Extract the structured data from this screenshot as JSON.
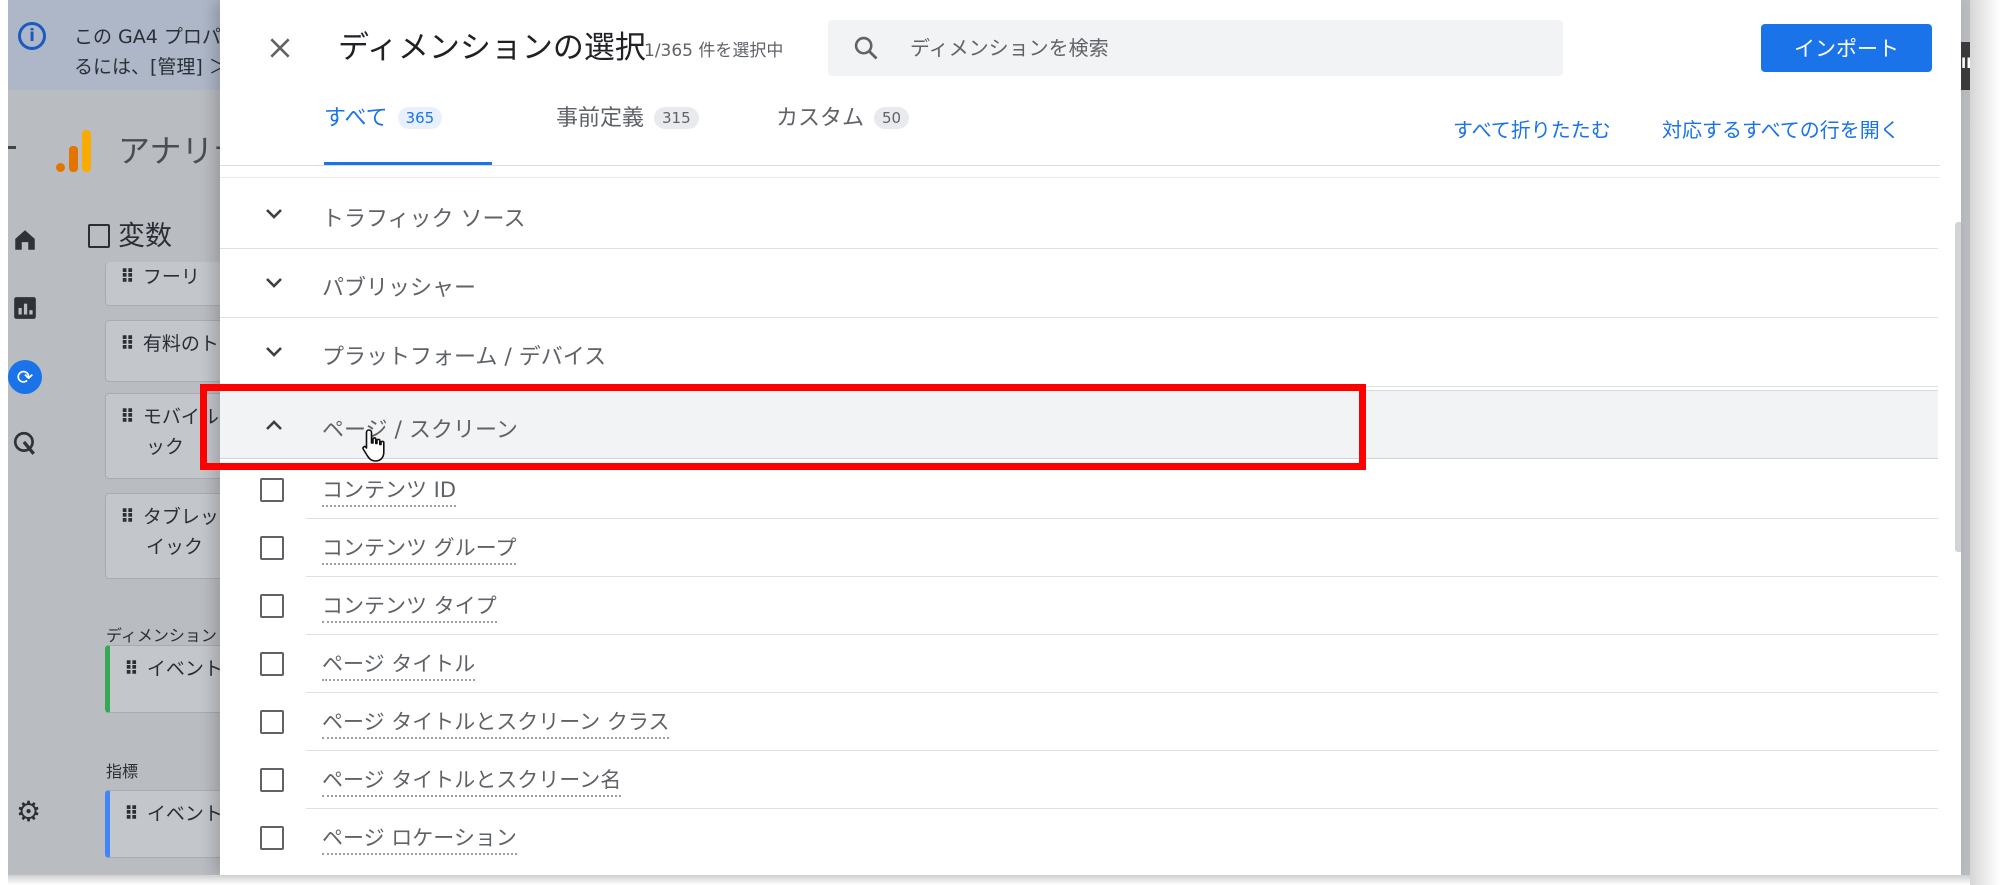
{
  "background": {
    "banner": {
      "line1": "この GA4 プロパ",
      "line2": "るには、[管理] ＞"
    },
    "app_name": "アナリテ",
    "variables_title": "変数",
    "cards": [
      "フーリ",
      "有料のト",
      "モバイル",
      "ック",
      "タブレッ",
      "イック"
    ],
    "dimensions_label": "ディメンション",
    "metrics_label": "指標",
    "event_card": "イベント",
    "metric_card": "イベント",
    "right_tab": "IN"
  },
  "dialog": {
    "title": "ディメンションの選択",
    "selected_count": "1/365 件を選択中",
    "search_placeholder": "ディメンションを検索",
    "import_label": "インポート",
    "tabs": [
      {
        "label": "すべて",
        "count": "365"
      },
      {
        "label": "事前定義",
        "count": "315"
      },
      {
        "label": "カスタム",
        "count": "50"
      }
    ],
    "collapse_all": "すべて折りたたむ",
    "expand_all": "対応するすべての行を開く",
    "categories": [
      "トラフィック ソース",
      "パブリッシャー",
      "プラットフォーム / デバイス",
      "ページ / スクリーン"
    ],
    "dimensions": [
      "コンテンツ ID",
      "コンテンツ グループ",
      "コンテンツ タイプ",
      "ページ タイトル",
      "ページ タイトルとスクリーン クラス",
      "ページ タイトルとスクリーン名",
      "ページ ロケーション"
    ]
  },
  "colors": {
    "accent": "#1a73e8",
    "highlight": "#ff0000"
  }
}
